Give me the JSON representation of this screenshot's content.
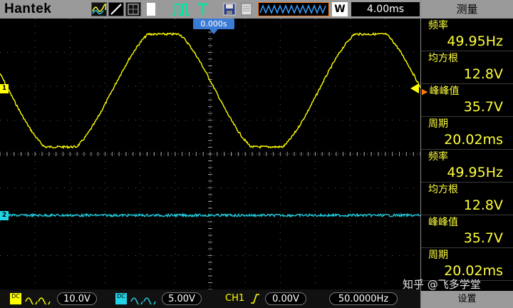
{
  "header": {
    "brand": "Hantek",
    "w_label": "W",
    "timebase": "4.00ms",
    "trigger_position": "0.000s"
  },
  "channels": {
    "ch1": {
      "color": "#ffff00",
      "marker": "1",
      "coupling": "DC",
      "volts_div": "10.0V"
    },
    "ch2": {
      "color": "#22d3e6",
      "marker": "2",
      "coupling": "DC",
      "volts_div": "5.00V"
    }
  },
  "trigger": {
    "source": "CH1",
    "level": "0.00V",
    "frequency": "50.0000Hz"
  },
  "measure_panel": {
    "title": "测量",
    "items": [
      {
        "label": "频率",
        "value": "49.95Hz",
        "selected": false
      },
      {
        "label": "均方根",
        "value": "12.8V",
        "selected": false
      },
      {
        "label": "峰峰值",
        "value": "35.7V",
        "selected": true
      },
      {
        "label": "周期",
        "value": "20.02ms",
        "selected": false
      },
      {
        "label": "频率",
        "value": "49.95Hz",
        "selected": false
      },
      {
        "label": "均方根",
        "value": "12.8V",
        "selected": false
      },
      {
        "label": "峰峰值",
        "value": "35.7V",
        "selected": false
      },
      {
        "label": "周期",
        "value": "20.02ms",
        "selected": false
      }
    ],
    "footer": "设置"
  },
  "watermark": "知乎 @飞多学堂"
}
